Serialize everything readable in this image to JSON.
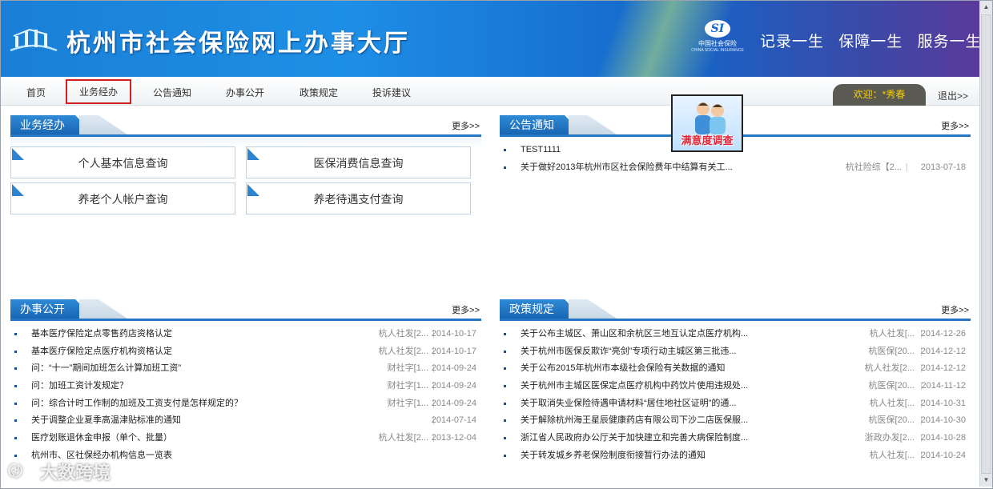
{
  "site": {
    "title": "杭州市社会保险网上办事大厅",
    "emblem_letters": "SI",
    "emblem_cn": "中国社会保险",
    "emblem_en": "CHINA SOCIAL INSURANCE",
    "slogans": [
      "记录一生",
      "保障一生",
      "服务一生"
    ]
  },
  "nav": {
    "items": [
      "首页",
      "业务经办",
      "公告通知",
      "办事公开",
      "政策规定",
      "投诉建议"
    ],
    "active_index": 1,
    "welcome": "欢迎：*秀春",
    "logout": "退出>>"
  },
  "survey": {
    "label": "满意度调查"
  },
  "panels": {
    "business": {
      "title": "业务经办",
      "more": "更多>>",
      "buttons": [
        "个人基本信息查询",
        "医保消费信息查询",
        "养老个人帐户查询",
        "养老待遇支付查询"
      ]
    },
    "notices": {
      "title": "公告通知",
      "more": "更多>>",
      "items": [
        {
          "title": "TEST1111",
          "source": "",
          "date": ""
        },
        {
          "title": "关于做好2013年杭州市区社会保险费年中结算有关工...",
          "source": "杭社险综【2...",
          "date": "2013-07-18"
        }
      ]
    },
    "affairs": {
      "title": "办事公开",
      "more": "更多>>",
      "items": [
        {
          "title": "基本医疗保险定点零售药店资格认定",
          "source": "杭人社发[2...",
          "date": "2014-10-17"
        },
        {
          "title": "基本医疗保险定点医疗机构资格认定",
          "source": "杭人社发[2...",
          "date": "2014-10-17"
        },
        {
          "title": "问：“十一”期间加班怎么计算加班工资”",
          "source": "财社字[1...",
          "date": "2014-09-24"
        },
        {
          "title": "问：加班工资计发规定？",
          "source": "财社字[1...",
          "date": "2014-09-24"
        },
        {
          "title": "问：综合计时工作制的加班及工资支付是怎样规定的？",
          "source": "财社字[1...",
          "date": "2014-09-24"
        },
        {
          "title": "关于调整企业夏季高温津贴标准的通知",
          "source": "",
          "date": "2014-07-14"
        },
        {
          "title": "医疗划账退休金申报（单个、批量）",
          "source": "杭人社发[2...",
          "date": "2013-12-04"
        },
        {
          "title": "杭州市、区社保经办机构信息一览表",
          "source": "",
          "date": ""
        }
      ]
    },
    "policy": {
      "title": "政策规定",
      "more": "更多>>",
      "items": [
        {
          "title": "关于公布主城区、萧山区和余杭区三地互认定点医疗机构...",
          "source": "杭人社发[...",
          "date": "2014-12-26"
        },
        {
          "title": "关于杭州市医保反欺诈“亮剑”专项行动主城区第三批违...",
          "source": "杭医保[20...",
          "date": "2014-12-12"
        },
        {
          "title": "关于公布2015年杭州市本级社会保险有关数据的通知",
          "source": "杭人社发[2...",
          "date": "2014-12-12"
        },
        {
          "title": "关于杭州市主城区医保定点医疗机构中药饮片使用违规处...",
          "source": "杭医保[20...",
          "date": "2014-11-12"
        },
        {
          "title": "关于取消失业保险待遇申请材料“居住地社区证明”的通...",
          "source": "杭人社发[...",
          "date": "2014-10-31"
        },
        {
          "title": "关于解除杭州海王星辰健康药店有限公司下沙二店医保服...",
          "source": "杭医保[20...",
          "date": "2014-10-30"
        },
        {
          "title": "浙江省人民政府办公厅关于加快建立和完善大病保险制度...",
          "source": "浙政办发[2...",
          "date": "2014-10-28"
        },
        {
          "title": "关于转发城乡养老保险制度衔接暂行办法的通知",
          "source": "杭人社发[...",
          "date": "2014-10-24"
        }
      ]
    }
  },
  "watermark": "大数跨境",
  "colors": {
    "banner": "#1e8fe6",
    "tab": "#1866b3",
    "active_border": "#d21f1f",
    "welcome_text": "#f5d000"
  }
}
